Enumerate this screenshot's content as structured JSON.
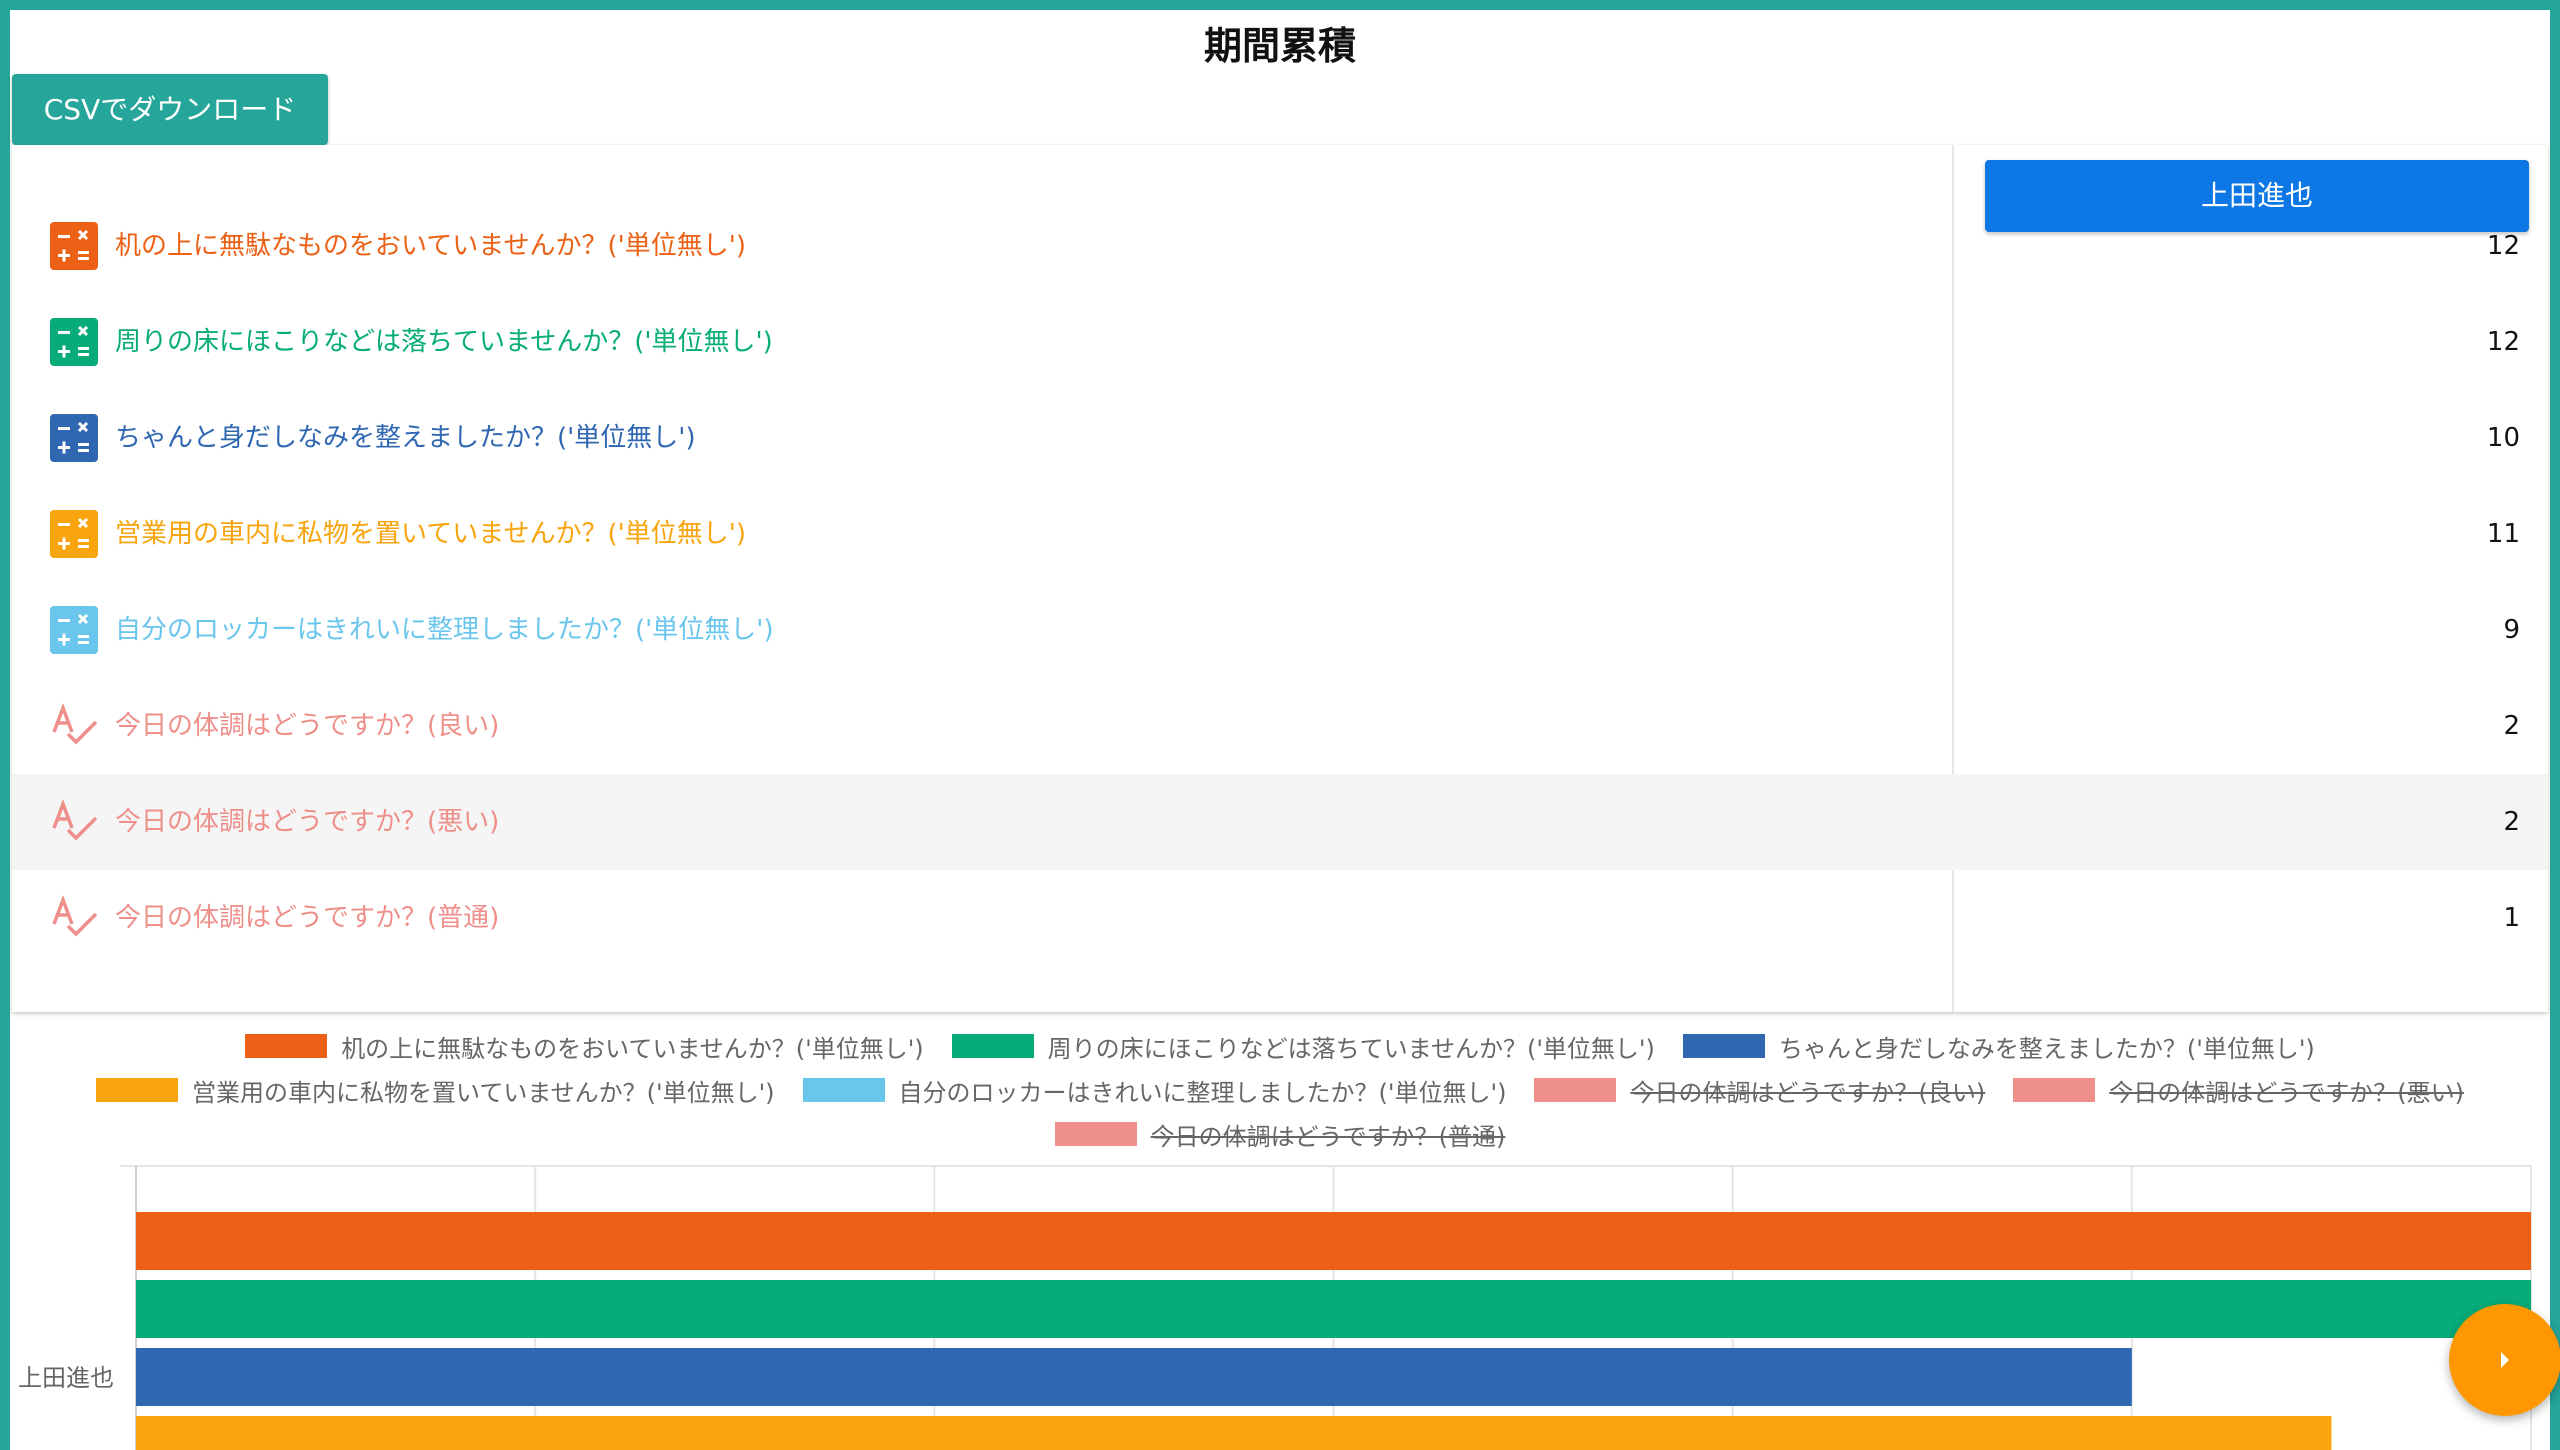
{
  "page": {
    "title": "期間累積",
    "csv_button_label": "CSVでダウンロード"
  },
  "table": {
    "column_header": "上田進也",
    "rows": [
      {
        "label": "机の上に無駄なものをおいていませんか？('単位無し')",
        "value": "12",
        "color": "#ec6115",
        "icon": "calculator-icon"
      },
      {
        "label": "周りの床にほこりなどは落ちていませんか？('単位無し')",
        "value": "12",
        "color": "#07ac79",
        "icon": "calculator-icon"
      },
      {
        "label": "ちゃんと身だしなみを整えましたか？('単位無し')",
        "value": "10",
        "color": "#2f67b2",
        "icon": "calculator-icon"
      },
      {
        "label": "営業用の車内に私物を置いていませんか？('単位無し')",
        "value": "11",
        "color": "#f8a40d",
        "icon": "calculator-icon"
      },
      {
        "label": "自分のロッカーはきれいに整理しましたか？('単位無し')",
        "value": "9",
        "color": "#6bc6ee",
        "icon": "calculator-icon"
      },
      {
        "label": "今日の体調はどうですか？(良い)",
        "value": "2",
        "color": "#ef8f8a",
        "icon": "spellcheck-icon"
      },
      {
        "label": "今日の体調はどうですか？(悪い)",
        "value": "2",
        "color": "#ef8f8a",
        "icon": "spellcheck-icon"
      },
      {
        "label": "今日の体調はどうですか？(普通)",
        "value": "1",
        "color": "#ef8f8a",
        "icon": "spellcheck-icon"
      }
    ]
  },
  "legend": {
    "items": [
      {
        "label": "机の上に無駄なものをおいていませんか？('単位無し')",
        "color": "#ec6115",
        "hidden": false
      },
      {
        "label": "周りの床にほこりなどは落ちていませんか？('単位無し')",
        "color": "#07ac79",
        "hidden": false
      },
      {
        "label": "ちゃんと身だしなみを整えましたか？('単位無し')",
        "color": "#2f67b2",
        "hidden": false
      },
      {
        "label": "営業用の車内に私物を置いていませんか？('単位無し')",
        "color": "#f8a40d",
        "hidden": false
      },
      {
        "label": "自分のロッカーはきれいに整理しましたか？('単位無し')",
        "color": "#6bc6ee",
        "hidden": false
      },
      {
        "label": "今日の体調はどうですか？(良い)",
        "color": "#ef8f8a",
        "hidden": true
      },
      {
        "label": "今日の体調はどうですか？(悪い)",
        "color": "#ef8f8a",
        "hidden": true
      },
      {
        "label": "今日の体調はどうですか？(普通)",
        "color": "#ef8f8a",
        "hidden": true
      }
    ]
  },
  "chart_data": {
    "type": "bar",
    "orientation": "horizontal",
    "categories": [
      "上田進也"
    ],
    "xlim": [
      0,
      12
    ],
    "grid": true,
    "legend_position": "top",
    "series": [
      {
        "name": "机の上に無駄なものをおいていませんか？('単位無し')",
        "values": [
          12
        ],
        "color": "#ec6115"
      },
      {
        "name": "周りの床にほこりなどは落ちていませんか？('単位無し')",
        "values": [
          12
        ],
        "color": "#07ac79"
      },
      {
        "name": "ちゃんと身だしなみを整えましたか？('単位無し')",
        "values": [
          10
        ],
        "color": "#2f67b2"
      },
      {
        "name": "営業用の車内に私物を置いていませんか？('単位無し')",
        "values": [
          11
        ],
        "color": "#f8a40d"
      }
    ]
  },
  "fab": {
    "icon": "chevron-right-icon",
    "color": "#ff9800"
  },
  "theme": {
    "accent": "#26a69a",
    "primary_button": "#0d77e6"
  }
}
